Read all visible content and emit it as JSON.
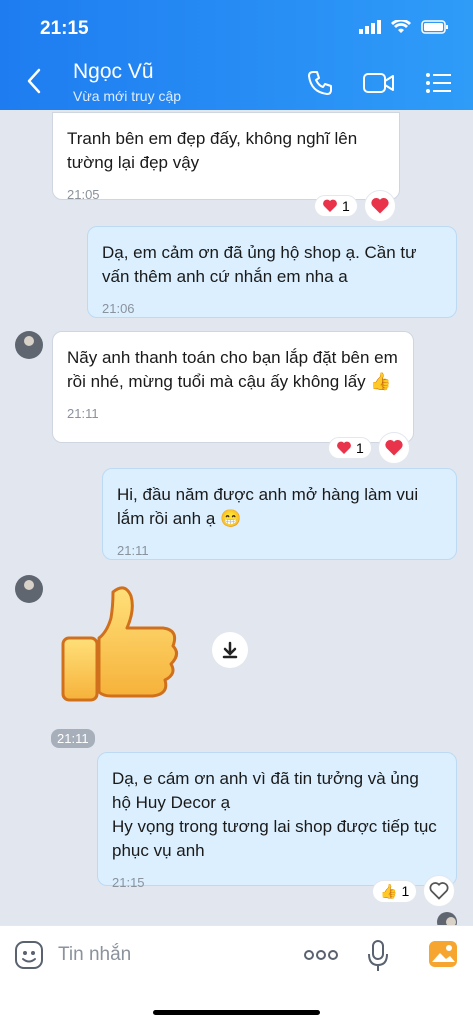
{
  "status": {
    "time": "21:15"
  },
  "header": {
    "name": "Ngọc Vũ",
    "status": "Vừa mới truy cập"
  },
  "messages": [
    {
      "dir": "in",
      "text": "Tranh bên em đẹp đấy, không nghĩ lên tường lại đẹp vậy",
      "time": "21:05",
      "react_count": "1"
    },
    {
      "dir": "out",
      "text": "Dạ, em cảm ơn đã ủng hộ shop ạ. Cần tư vấn thêm anh cứ nhắn em nha a",
      "time": "21:06"
    },
    {
      "dir": "in",
      "text": "Nãy anh thanh toán cho bạn lắp đặt bên em rồi nhé, mừng tuổi mà cậu ấy không lấy 👍",
      "time": "21:11",
      "react_count": "1"
    },
    {
      "dir": "out",
      "text": "Hi, đầu năm được anh mở hàng làm vui lắm rồi anh ạ 😁",
      "time": "21:11"
    },
    {
      "dir": "in",
      "type": "sticker",
      "sticker": "thumbs-up",
      "time": "21:11"
    },
    {
      "dir": "out",
      "text": "Dạ, e cám ơn anh vì đã tin tưởng và ủng hộ Huy Decor ạ\nHy vọng trong tương lai shop được tiếp tục phục vụ anh",
      "time": "21:15",
      "react_count": "1"
    }
  ],
  "composer": {
    "placeholder": "Tin nhắn"
  },
  "colors": {
    "header": "#1e7cf0",
    "out_bubble": "#dbeffe",
    "in_bubble": "#ffffff",
    "heart": "#e8334a"
  },
  "icons": [
    "back-icon",
    "phone-icon",
    "video-call-icon",
    "list-menu-icon",
    "sticker-icon",
    "more-icon",
    "microphone-icon",
    "gallery-icon",
    "download-icon",
    "heart-icon"
  ]
}
